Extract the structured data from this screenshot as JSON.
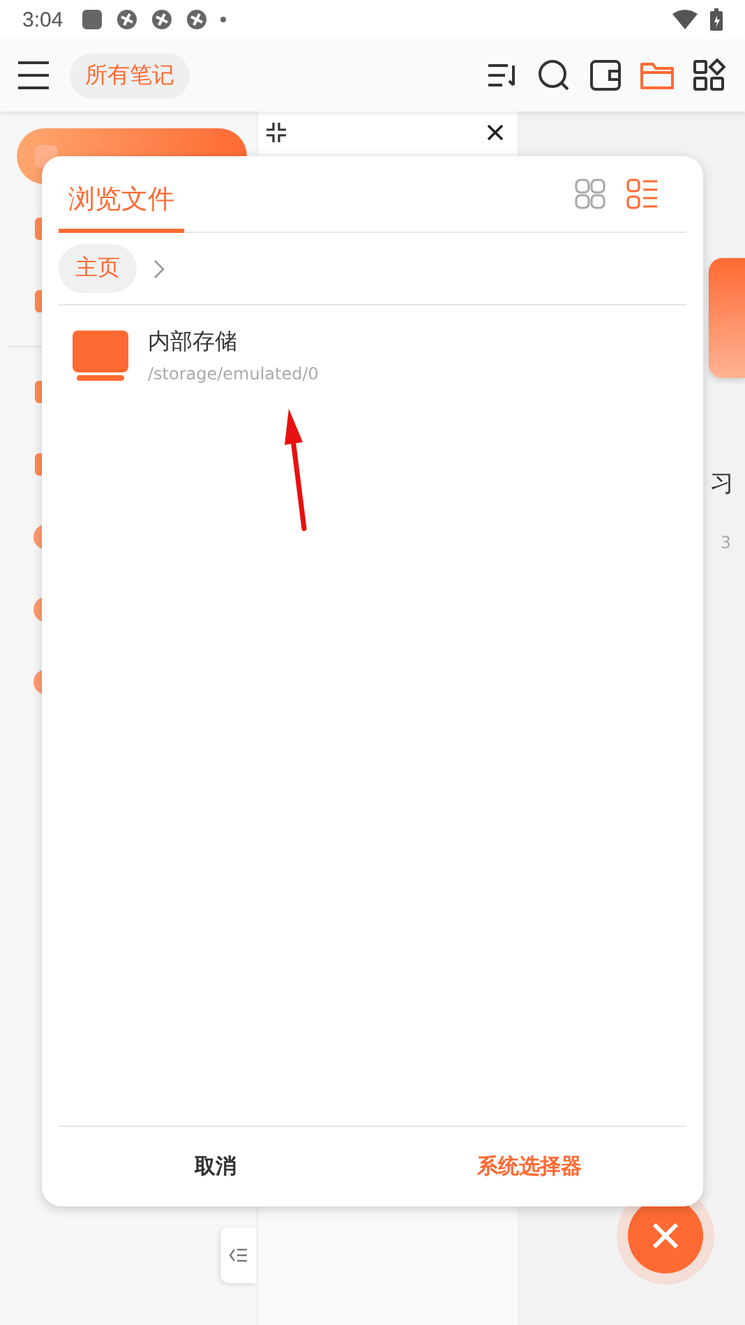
{
  "status_bar": {
    "time": "3:04"
  },
  "app_bar": {
    "title_chip": "所有笔记",
    "tools": [
      {
        "kind": "sort",
        "selected": false
      },
      {
        "kind": "search",
        "selected": false
      },
      {
        "kind": "wallet",
        "selected": false
      },
      {
        "kind": "folder",
        "selected": true
      },
      {
        "kind": "apps",
        "selected": false
      }
    ]
  },
  "sidebar": {
    "items": [
      {
        "kind": "square",
        "selected": true
      },
      {
        "kind": "square",
        "selected": false
      },
      {
        "kind": "square",
        "selected": false
      },
      {
        "kind": "square",
        "selected": false
      },
      {
        "kind": "square",
        "selected": false
      },
      {
        "kind": "round",
        "selected": false
      },
      {
        "kind": "round",
        "selected": false
      },
      {
        "kind": "round",
        "selected": false
      }
    ]
  },
  "note_preview": {
    "title": "习",
    "date": "3"
  },
  "dialog": {
    "title": "浏览文件",
    "view_modes": [
      {
        "kind": "grid",
        "selected": false
      },
      {
        "kind": "list",
        "selected": true
      }
    ],
    "breadcrumb": [
      {
        "label": "主页"
      }
    ],
    "items": [
      {
        "name": "内部存储",
        "path": "/storage/emulated/0"
      }
    ],
    "buttons": [
      {
        "label": "取消",
        "kind": "cancel"
      },
      {
        "label": "系统选择器",
        "kind": "primary"
      }
    ]
  },
  "annotations": [
    {
      "kind": "arrow"
    }
  ]
}
